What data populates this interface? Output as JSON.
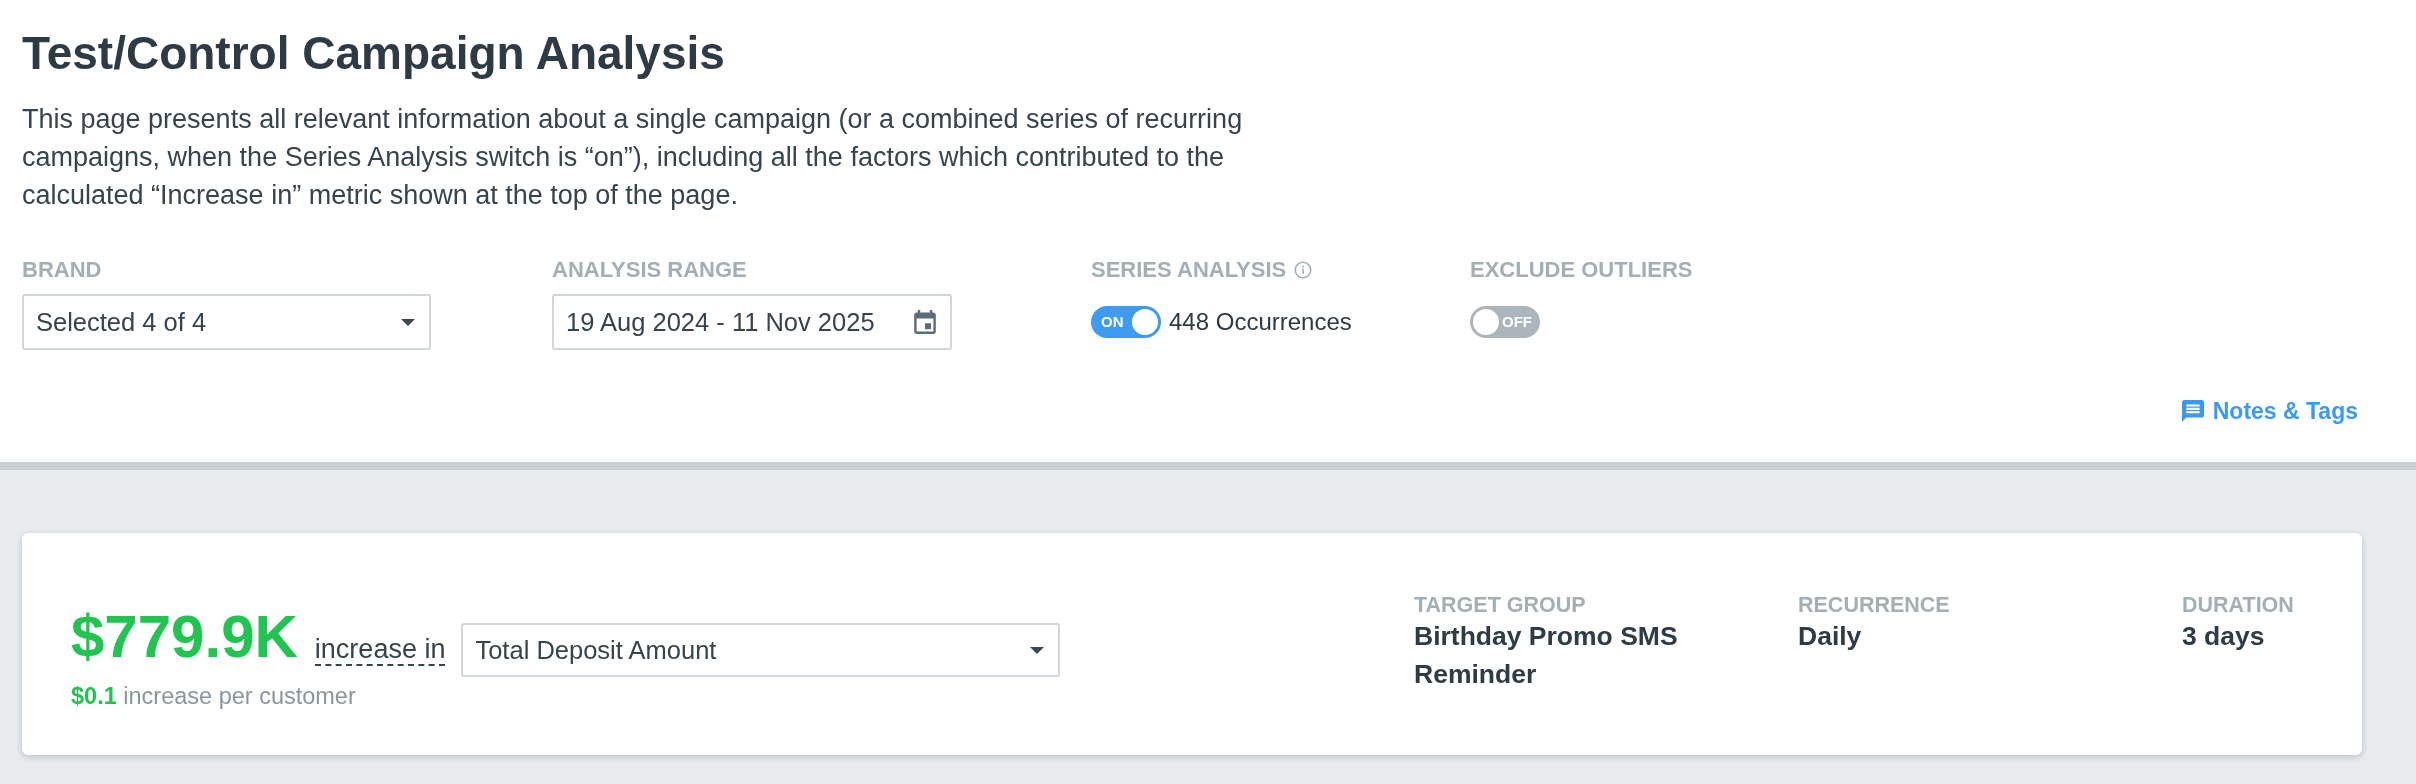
{
  "header": {
    "title": "Test/Control Campaign Analysis",
    "description": "This page presents all relevant information about a single campaign (or a combined series of recurring campaigns, when the Series Analysis switch is “on”), including all the factors which contributed to the calculated “Increase in” metric shown at the top of the page."
  },
  "filters": [
    {
      "kind": "select",
      "label": "BRAND",
      "value": "Selected 4 of 4"
    },
    {
      "kind": "date",
      "label": "ANALYSIS RANGE",
      "value": "19 Aug 2024 - 11 Nov 2025"
    },
    {
      "kind": "switch",
      "label": "SERIES ANALYSIS",
      "info": true,
      "on": true,
      "switch_text": "ON",
      "note": "448 Occurrences"
    },
    {
      "kind": "switch",
      "label": "EXCLUDE OUTLIERS",
      "info": false,
      "on": false,
      "switch_text": "OFF"
    }
  ],
  "notes_link": "Notes & Tags",
  "summary": {
    "amount": "$779.9K",
    "connector": "increase in",
    "metric": "Total Deposit Amount",
    "per_customer": "**$0.1** increase per customer",
    "details": [
      {
        "label": "TARGET GROUP",
        "value": "Birthday Promo SMS Reminder"
      },
      {
        "label": "RECURRENCE",
        "value": "Daily"
      },
      {
        "label": "DURATION",
        "value": "3 days"
      }
    ]
  }
}
